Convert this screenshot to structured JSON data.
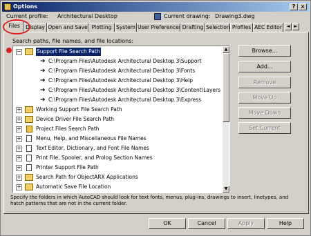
{
  "window": {
    "title": "Options",
    "help_glyph": "?",
    "close_glyph": "×"
  },
  "profile": {
    "label": "Current profile:",
    "value": "Architectural Desktop",
    "drawing_label": "Current drawing:",
    "drawing_value": "Drawing3.dwg"
  },
  "tabs": [
    {
      "label": "Files",
      "active": true
    },
    {
      "label": "Display"
    },
    {
      "label": "Open and Save"
    },
    {
      "label": "Plotting"
    },
    {
      "label": "System"
    },
    {
      "label": "User Preferences"
    },
    {
      "label": "Drafting"
    },
    {
      "label": "Selection"
    },
    {
      "label": "Profiles"
    },
    {
      "label": "AEC Editor"
    }
  ],
  "tab_scroll": {
    "left": "◄",
    "right": "►"
  },
  "tree": {
    "heading": "Search paths, file names, and file locations:",
    "items": [
      {
        "label": "Support File Search Path",
        "expander": "−",
        "icon": "folder-icon",
        "selected": true
      },
      {
        "label": "C:\\Program Files\\Autodesk Architectural Desktop 3\\Support",
        "icon": "arrow-icon"
      },
      {
        "label": "C:\\Program Files\\Autodesk Architectural Desktop 3\\Fonts",
        "icon": "arrow-icon"
      },
      {
        "label": "C:\\Program Files\\Autodesk Architectural Desktop 3\\Help",
        "icon": "arrow-icon"
      },
      {
        "label": "C:\\Program Files\\Autodesk Architectural Desktop 3\\Content\\Layers",
        "icon": "arrow-icon"
      },
      {
        "label": "C:\\Program Files\\Autodesk Architectural Desktop 3\\Express",
        "icon": "arrow-icon"
      },
      {
        "label": "Working Support File Search Path",
        "expander": "+",
        "icon": "folder-icon"
      },
      {
        "label": "Device Driver File Search Path",
        "expander": "+",
        "icon": "folder-icon"
      },
      {
        "label": "Project Files Search Path",
        "expander": "+",
        "icon": "project-icon"
      },
      {
        "label": "Menu, Help, and Miscellaneous File Names",
        "expander": "+",
        "icon": "document-icon"
      },
      {
        "label": "Text Editor, Dictionary, and Font File Names",
        "expander": "+",
        "icon": "document-icon"
      },
      {
        "label": "Print File, Spooler, and Prolog Section Names",
        "expander": "+",
        "icon": "document-icon"
      },
      {
        "label": "Printer Support File Path",
        "expander": "+",
        "icon": "document-icon"
      },
      {
        "label": "Search Path for ObjectARX Applications",
        "expander": "+",
        "icon": "folder-icon"
      },
      {
        "label": "Automatic Save File Location",
        "expander": "+",
        "icon": "folder-icon"
      }
    ]
  },
  "side_buttons": [
    {
      "label": "Browse...",
      "enabled": true
    },
    {
      "label": "Add...",
      "enabled": true
    },
    {
      "label": "Remove",
      "enabled": false
    },
    {
      "label": "Move Up",
      "enabled": false
    },
    {
      "label": "Move Down",
      "enabled": false
    },
    {
      "label": "Set Current",
      "enabled": false
    }
  ],
  "description": "Specify the folders in which AutoCAD should look for text fonts, menus, plug-ins, drawings to insert, linetypes, and hatch patterns that are not in the current folder.",
  "bottom_buttons": [
    {
      "label": "OK",
      "enabled": true
    },
    {
      "label": "Cancel",
      "enabled": true
    },
    {
      "label": "Apply",
      "enabled": false
    },
    {
      "label": "Help",
      "enabled": true
    }
  ],
  "scroll_glyphs": {
    "up": "▲",
    "down": "▼"
  },
  "colors": {
    "selection": "#0a246a",
    "annotation": "#e02020",
    "titlebar": "#0a246a"
  }
}
